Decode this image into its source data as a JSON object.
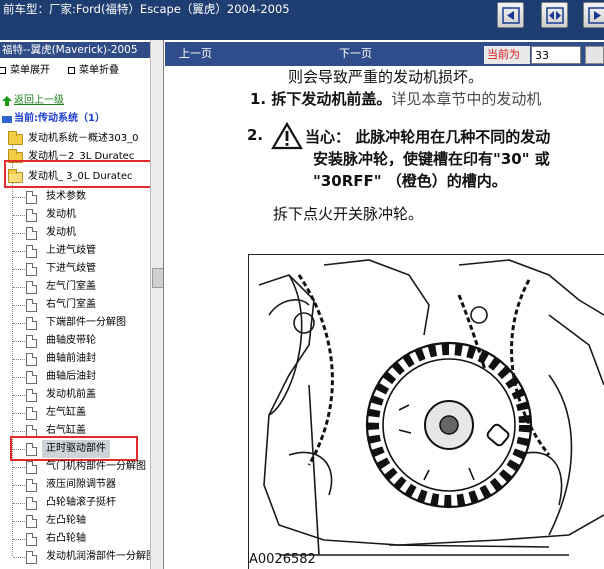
{
  "window": {
    "title": "前车型：厂家:Ford(福特）Escape（翼虎）2004-2005"
  },
  "left_pane": {
    "header": "福特--翼虎(Maverick)-2005",
    "expand_label": "菜单展开",
    "collapse_label": "菜单折叠",
    "back_label": "返回上一级",
    "current_label": "当前:传动系统（1）",
    "folders": [
      "发动机系统－概述303_0",
      "发动机－2_3L Duratec",
      "发动机_ 3_0L Duratec"
    ],
    "items": [
      "技术参数",
      "发动机",
      "发动机",
      "上进气歧管",
      "下进气歧管",
      "左气门室盖",
      "右气门室盖",
      "下端部件一分解图",
      "曲轴皮带轮",
      "曲轴前油封",
      "曲轴后油封",
      "发动机前盖",
      "左气缸盖",
      "右气缸盖",
      "正时驱动部件",
      "气门机构部件一分解图",
      "液压间隙调节器",
      "凸轮轴滚子挺杆",
      "左凸轮轴",
      "右凸轮轴",
      "发动机润滑部件一分解图"
    ],
    "selected_item": "正时驱动部件"
  },
  "nav": {
    "prev_label": "上一页",
    "next_label": "下一页",
    "current_label": "当前为",
    "page_value": "33"
  },
  "doc": {
    "line1": "则会导致严重的发动机损坏。",
    "step1_text": "1. 拆下发动机前盖。",
    "step1_ref": "详见本章节中的发动机",
    "step2_prefix": "2.",
    "caution_text": "当心：  此脉冲轮用在几种不同的发动",
    "caution_line2": "安装脉冲轮，使键槽在印有\"30\" 或",
    "caution_line3": "\"30RFF\" （橙色）的槽内。",
    "step_remove": "拆下点火开关脉冲轮。",
    "figure_id": "A0026582"
  }
}
